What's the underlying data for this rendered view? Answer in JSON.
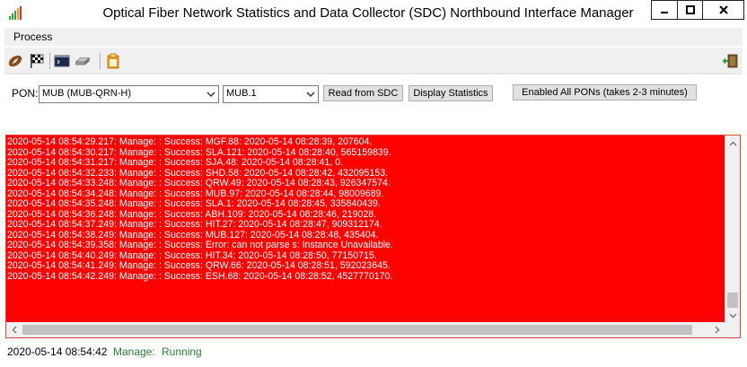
{
  "window": {
    "title": "Optical Fiber Network Statistics and Data Collector (SDC) Northbound Interface Manager",
    "icon": "signal-bars-icon"
  },
  "menu": {
    "items": [
      {
        "label": "Process"
      }
    ]
  },
  "toolbar": {
    "icons": [
      "football-icon",
      "checkered-flag-icon",
      "terminal-icon",
      "hard-drive-icon",
      "clipboard-icon",
      "exit-icon"
    ]
  },
  "controls": {
    "pon_label": "PON:",
    "pon_select_value": "MUB (MUB-QRN-H)",
    "port_select_value": "MUB.1",
    "read_button": "Read from SDC",
    "stats_button": "Display Statistics",
    "enable_all_button": "Enabled All PONs (takes 2-3 minutes)"
  },
  "log": {
    "background": "#ff0000",
    "lines": [
      "2020-05-14 08:54:29.217: Manage: : Success: MGF.88: 2020-05-14 08:28:39, 207604.",
      "2020-05-14 08:54:30.217: Manage: : Success: SLA.121: 2020-05-14 08:28:40, 565159839.",
      "2020-05-14 08:54:31.217: Manage: : Success: SJA.48: 2020-05-14 08:28:41, 0.",
      "2020-05-14 08:54:32.233: Manage: : Success: SHD.58: 2020-05-14 08:28:42, 432095153.",
      "2020-05-14 08:54:33.248: Manage: : Success: QRW.49: 2020-05-14 08:28:43, 926347574.",
      "2020-05-14 08:54:34.248: Manage: : Success: MUB.97: 2020-05-14 08:28:44, 98009689.",
      "2020-05-14 08:54:35.248: Manage: : Success: SLA.1: 2020-05-14 08:28:45, 335840439.",
      "2020-05-14 08:54:36.248: Manage: : Success: ABH.109: 2020-05-14 08:28:46, 219028.",
      "2020-05-14 08:54:37.249: Manage: : Success: HIT.27: 2020-05-14 08:28:47, 909312174.",
      "2020-05-14 08:54:38.249: Manage: : Success: MUB.127: 2020-05-14 08:28:48, 435404.",
      "2020-05-14 08:54:39.358: Manage: : Success: Error: can not parse s: Instance Unavailable.",
      "2020-05-14 08:54:40.249: Manage: : Success: HIT.34: 2020-05-14 08:28:50, 77150715.",
      "2020-05-14 08:54:41.249: Manage: : Success: QRW.66: 2020-05-14 08:28:51, 592023645.",
      "2020-05-14 08:54:42.249: Manage: : Success: ESH.68: 2020-05-14 08:28:52, 4527770170."
    ]
  },
  "status": {
    "time": "2020-05-14 08:54:42",
    "manage": "Manage:",
    "state": "Running",
    "color": "#2e7d32"
  }
}
